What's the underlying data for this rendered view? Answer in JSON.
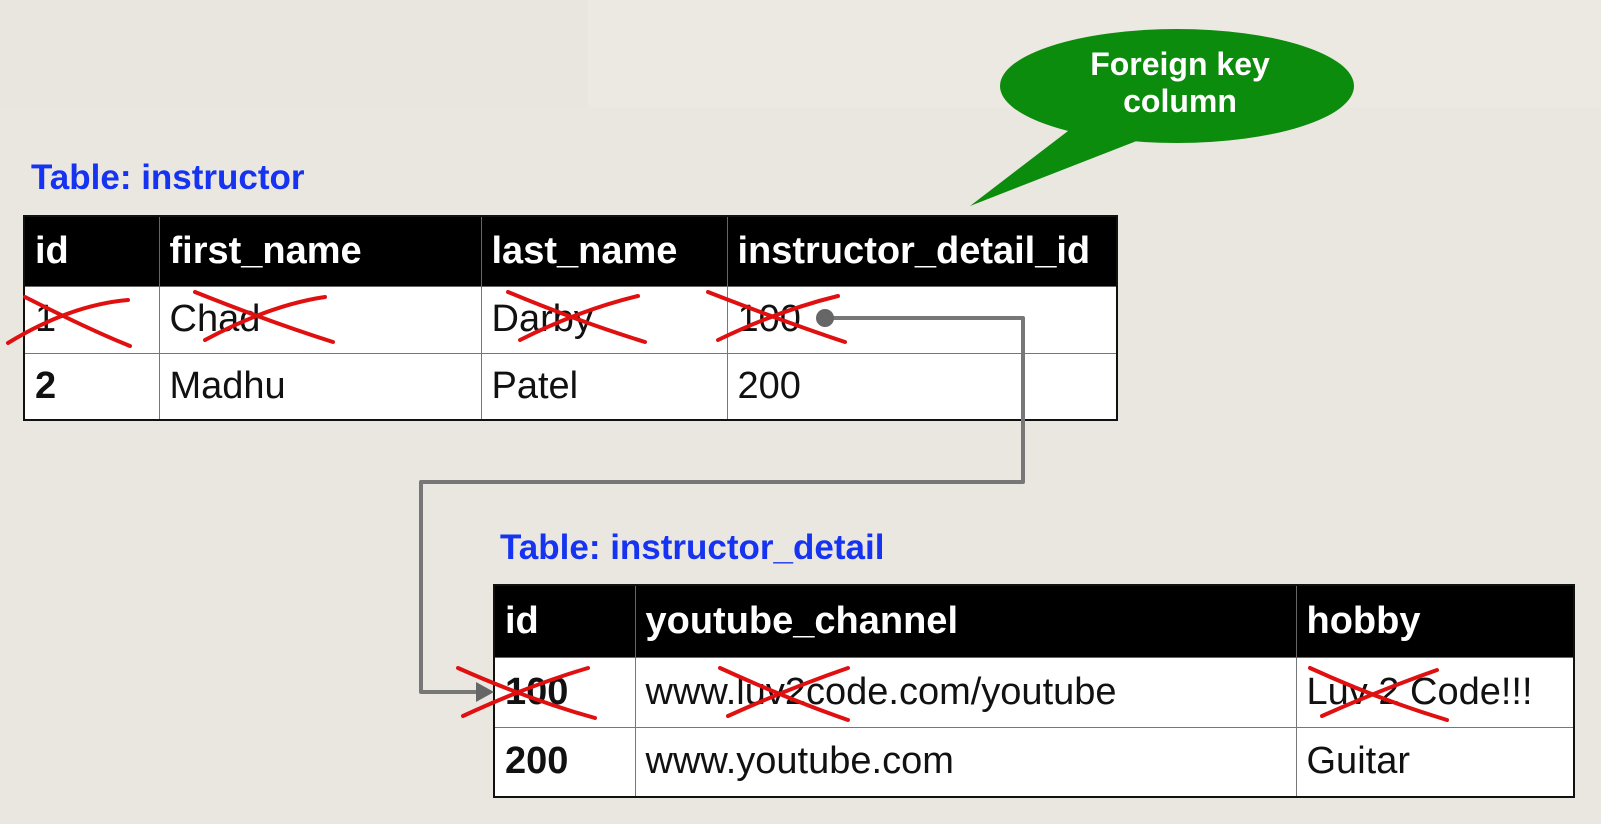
{
  "callout": {
    "text": "Foreign key column"
  },
  "instructor": {
    "title": "Table: instructor",
    "columns": [
      "id",
      "first_name",
      "last_name",
      "instructor_detail_id"
    ],
    "rows": [
      [
        "1",
        "Chad",
        "Darby",
        "100"
      ],
      [
        "2",
        "Madhu",
        "Patel",
        "200"
      ]
    ]
  },
  "instructor_detail": {
    "title": "Table: instructor_detail",
    "columns": [
      "id",
      "youtube_channel",
      "hobby"
    ],
    "rows": [
      [
        "100",
        "www.luv2code.com/youtube",
        "Luv 2 Code!!!"
      ],
      [
        "200",
        "www.youtube.com",
        "Guitar"
      ]
    ]
  },
  "colors": {
    "title_blue": "#1533f0",
    "callout_green": "#0c8c0c",
    "cross_red": "#e01010",
    "connector_gray": "#777777",
    "header_black": "#000000"
  },
  "deleted_row": {
    "instructor_row": 0,
    "instructor_detail_row": 0
  }
}
